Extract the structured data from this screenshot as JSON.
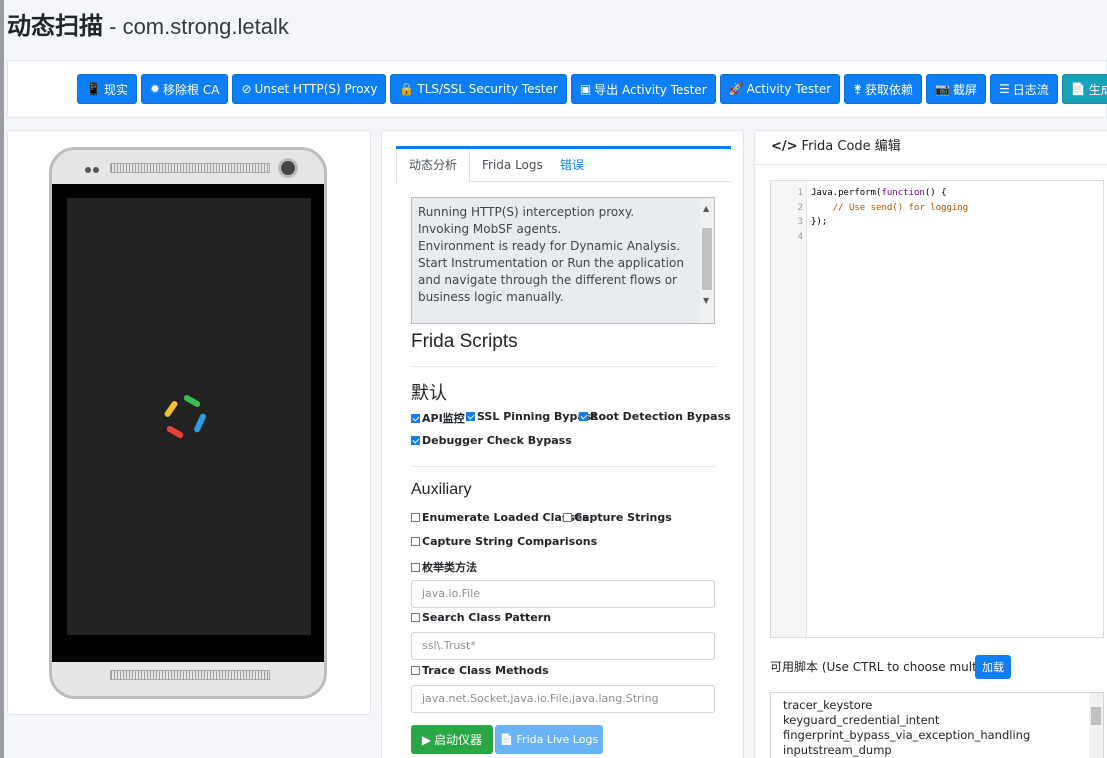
{
  "header": {
    "title": "动态扫描",
    "separator": " - ",
    "package": "com.strong.letalk"
  },
  "toolbar": {
    "buttons": [
      {
        "icon": "📱",
        "label": "现实"
      },
      {
        "icon": "✹",
        "label": "移除根 CA"
      },
      {
        "icon": "⊘",
        "label": "Unset HTTP(S) Proxy"
      },
      {
        "icon": "🔒",
        "label": "TLS/SSL Security Tester"
      },
      {
        "icon": "▣",
        "label": "导出 Activity Tester"
      },
      {
        "icon": "🚀",
        "label": "Activity Tester"
      },
      {
        "icon": "⚵",
        "label": "获取依赖"
      },
      {
        "icon": "📷",
        "label": "截屏"
      },
      {
        "icon": "☰",
        "label": "日志流"
      },
      {
        "icon": "📄",
        "label": "生成报告"
      }
    ]
  },
  "tabs": {
    "analysis": "动态分析",
    "frida_logs": "Frida Logs",
    "errors": "错误"
  },
  "log": {
    "lines": [
      "Running HTTP(S) interception proxy.",
      "Invoking MobSF agents.",
      "Environment is ready for Dynamic Analysis.",
      "Start Instrumentation or Run the application and navigate through the different flows or business logic manually."
    ]
  },
  "frida": {
    "title": "Frida Scripts",
    "default_heading": "默认",
    "api_monitor": "API监控",
    "ssl_bypass": "SSL Pinning Bypass",
    "root_bypass": "Root Detection Bypass",
    "debugger_bypass": "Debugger Check Bypass",
    "aux_heading": "Auxiliary",
    "enum_classes": "Enumerate Loaded Classes",
    "capture_strings": "Capture Strings",
    "capture_compare": "Capture String Comparisons",
    "enum_methods": "枚举类方法",
    "enum_methods_placeholder": "java.io.File",
    "search_pattern": "Search Class Pattern",
    "search_pattern_placeholder": "ssl\\.Trust*",
    "trace_methods": "Trace Class Methods",
    "trace_methods_placeholder": "java.net.Socket,java.io.File,java.lang.String",
    "start_label": "启动仪器",
    "live_logs_label": "Frida Live Logs"
  },
  "editor": {
    "heading": "Frida Code 编辑",
    "line_numbers": [
      "1",
      "2",
      "3",
      "4"
    ]
  },
  "scripts": {
    "available_label": "可用脚本 (Use CTRL to choose multiple)",
    "load_label": "加载",
    "items": [
      "tracer_keystore",
      "keyguard_credential_intent",
      "fingerprint_bypass_via_exception_handling",
      "inputstream_dump"
    ]
  },
  "colors": {
    "primary": "#0d7ef6",
    "teal": "#17a2b8",
    "success": "#28a745"
  }
}
